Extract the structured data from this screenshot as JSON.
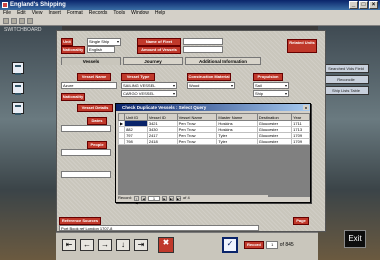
{
  "window": {
    "title": "England's Shipping"
  },
  "menu": [
    "File",
    "Edit",
    "View",
    "Insert",
    "Format",
    "Records",
    "Tools",
    "Window",
    "Help"
  ],
  "background": {
    "switchboard_label": "SWITCHBOARD",
    "right_buttons": [
      "Searched Vids Field",
      "Reconcile",
      "Ship Lists Table"
    ]
  },
  "header": {
    "unit_label": "Unit",
    "unit_value": "Single Ship",
    "nationality_label": "Nationality",
    "nationality_value": "English",
    "fleet_label": "Name of Fleet",
    "amount_label": "Amount of Vessels",
    "related_units_label": "Related Units"
  },
  "tabs": [
    "Vessels",
    "Journey",
    "Additional Information"
  ],
  "vessel_tab": {
    "vessel_name_label": "Vessel Name",
    "vessel_type_label": "Vessel Type",
    "vessel_type_values": [
      "SAILING VESSEL",
      "CARGO VESSEL"
    ],
    "construction_label": "Construction Material",
    "construction_value": "Wood",
    "propulsion_label": "Propulsion",
    "propulsion_value": "Sail",
    "rig_value": "Ship",
    "nationality_label": "Nationality",
    "nationality_value": "Azure",
    "details_label": "Vessel Details",
    "dates_label": "Dates",
    "people_label": "People"
  },
  "dialog": {
    "title": "Check Duplicate Vessels : Select Query",
    "close": "x",
    "columns": [
      "Unit ID",
      "Vessel ID",
      "Vessel Name",
      "Master Name",
      "Destination",
      "Year"
    ],
    "rows": [
      [
        "",
        "3421",
        "Pen Trow",
        "Hoskins",
        "Gloucester",
        "1711"
      ],
      [
        "882",
        "3430",
        "Pen Trow",
        "Hoskins",
        "Gloucester",
        "1713"
      ],
      [
        "797",
        "2417",
        "Pen Trow",
        "Tyler",
        "Gloucester",
        "1709"
      ],
      [
        "798",
        "2418",
        "Pen Trow",
        "Tyler",
        "Gloucester",
        "1709"
      ]
    ],
    "record_label": "Record:",
    "record_current": "1",
    "record_of": "of 4",
    "nav": [
      "|◀",
      "◀",
      "▶",
      "▶|",
      "▶*"
    ]
  },
  "bottom": {
    "reference_label": "Reference Sources",
    "source_value": "Port Book ref London 1707-8",
    "page_label": "Page",
    "record_label": "Record",
    "record_value": "1",
    "record_of": "of 845",
    "exit_label": "Exit"
  },
  "colors": {
    "label_red": "#c0392b",
    "title_blue": "#0a246a",
    "form_stone": "#c9c6bc"
  }
}
